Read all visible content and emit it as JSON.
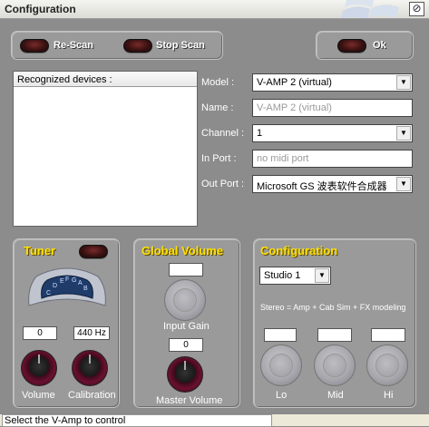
{
  "window": {
    "title": "Configuration",
    "restore_icon": "restore-icon"
  },
  "toolbar": {
    "rescan": "Re-Scan",
    "stopscan": "Stop Scan",
    "ok": "Ok"
  },
  "devices": {
    "header": "Recognized devices :"
  },
  "form": {
    "model": {
      "label": "Model :",
      "value": "V-AMP 2 (virtual)"
    },
    "name": {
      "label": "Name :",
      "value": "V-AMP 2 (virtual)"
    },
    "channel": {
      "label": "Channel :",
      "value": "1"
    },
    "inport": {
      "label": "In Port :",
      "value": "no midi port"
    },
    "outport": {
      "label": "Out Port :",
      "value": "Microsoft GS 波表软件合成器"
    }
  },
  "tuner": {
    "title": "Tuner",
    "notes": [
      "C",
      "D",
      "E",
      "F",
      "G",
      "A",
      "B"
    ],
    "volume_value": "0",
    "calibration_value": "440 Hz",
    "volume_label": "Volume",
    "calibration_label": "Calibration"
  },
  "global_volume": {
    "title": "Global Volume",
    "input_gain_value": "",
    "input_gain_label": "Input Gain",
    "master_value": "0",
    "master_label": "Master Volume"
  },
  "configuration": {
    "title": "Configuration",
    "studio_value": "Studio 1",
    "description": "Stereo = Amp + Cab Sim + FX modeling",
    "lo_value": "",
    "mid_value": "",
    "hi_value": "",
    "lo_label": "Lo",
    "mid_label": "Mid",
    "hi_label": "Hi"
  },
  "status": {
    "text": "Select the V-Amp to control"
  },
  "colors": {
    "panel": "#9a9a9a",
    "accent": "#ffe000",
    "led": "#5a1a1a"
  }
}
